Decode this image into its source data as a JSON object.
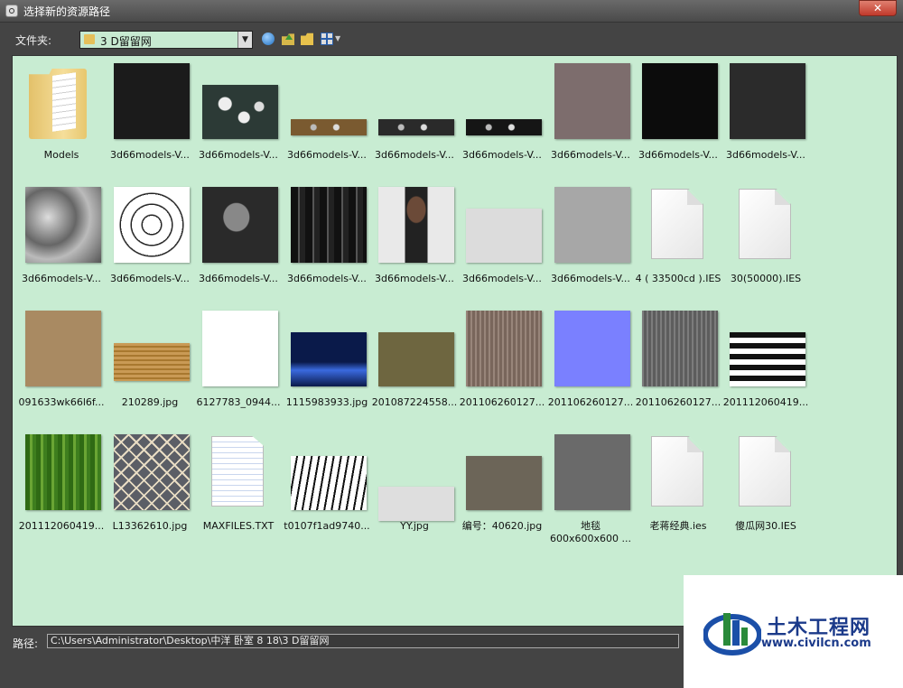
{
  "window": {
    "title": "选择新的资源路径",
    "close_label": "✕"
  },
  "toolbar": {
    "folder_label": "文件夹:",
    "current_folder": "3 D留留网"
  },
  "path": {
    "label": "路径:",
    "value": "C:\\Users\\Administrator\\Desktop\\中洋 卧室 8 18\\3 D留留网"
  },
  "watermark": {
    "brand": "土木工程网",
    "url": "www.civilcn.com"
  },
  "files": [
    {
      "label": "Models",
      "kind": "folder"
    },
    {
      "label": "3d66models-V...",
      "kind": "img",
      "color": "#1b1b1b",
      "shape": "sq"
    },
    {
      "label": "3d66models-V...",
      "kind": "img",
      "color": "#2c3a36",
      "shape": "wide",
      "pattern": "dandelion"
    },
    {
      "label": "3d66models-V...",
      "kind": "img",
      "color": "#7a5a30",
      "shape": "strip"
    },
    {
      "label": "3d66models-V...",
      "kind": "img",
      "color": "#2a2a2a",
      "shape": "strip"
    },
    {
      "label": "3d66models-V...",
      "kind": "img",
      "color": "#151515",
      "shape": "strip"
    },
    {
      "label": "3d66models-V...",
      "kind": "img",
      "color": "#7d6d6d",
      "shape": "sq"
    },
    {
      "label": "3d66models-V...",
      "kind": "img",
      "color": "#0c0c0c",
      "shape": "sq"
    },
    {
      "label": "3d66models-V...",
      "kind": "img",
      "color": "#2b2b2b",
      "shape": "sq"
    },
    {
      "label": "3d66models-V...",
      "kind": "img",
      "color": "#8b8b8b",
      "shape": "sq",
      "pattern": "marble"
    },
    {
      "label": "3d66models-V...",
      "kind": "img",
      "color": "#ffffff",
      "shape": "sq",
      "pattern": "flower"
    },
    {
      "label": "3d66models-V...",
      "kind": "img",
      "color": "#2a2a2a",
      "shape": "sq",
      "pattern": "leaf"
    },
    {
      "label": "3d66models-V...",
      "kind": "img",
      "color": "#1f1f1f",
      "shape": "sq",
      "pattern": "stripes-v"
    },
    {
      "label": "3d66models-V...",
      "kind": "img",
      "color": "#e9e9e9",
      "shape": "sq",
      "pattern": "person"
    },
    {
      "label": "3d66models-V...",
      "kind": "img",
      "color": "#dcdcdc",
      "shape": "wide"
    },
    {
      "label": "3d66models-V...",
      "kind": "img",
      "color": "#a7a7a7",
      "shape": "sq"
    },
    {
      "label": "4 ( 33500cd ).IES",
      "kind": "doc"
    },
    {
      "label": "30(50000).IES",
      "kind": "doc"
    },
    {
      "label": "091633wk66l6f...",
      "kind": "img",
      "color": "#a98a62",
      "shape": "sq"
    },
    {
      "label": "210289.jpg",
      "kind": "img",
      "color": "#b98a45",
      "shape": "strip2",
      "pattern": "wood"
    },
    {
      "label": "6127783_0944...",
      "kind": "img",
      "color": "#ffffff",
      "shape": "sq",
      "pattern": "tower"
    },
    {
      "label": "1115983933.jpg",
      "kind": "img",
      "color": "#0e2a6a",
      "shape": "wide",
      "pattern": "city"
    },
    {
      "label": "201087224558...",
      "kind": "img",
      "color": "#6e6640",
      "shape": "wide"
    },
    {
      "label": "201106260127...",
      "kind": "img",
      "color": "#8a7468",
      "shape": "sq",
      "pattern": "stripes-fine"
    },
    {
      "label": "201106260127...",
      "kind": "img",
      "color": "#7a80ff",
      "shape": "sq"
    },
    {
      "label": "201106260127...",
      "kind": "img",
      "color": "#6a6a6a",
      "shape": "sq",
      "pattern": "stripes-fine"
    },
    {
      "label": "201112060419...",
      "kind": "img",
      "color": "#ffffff",
      "shape": "wide",
      "pattern": "bw-stripes"
    },
    {
      "label": "201112060419...",
      "kind": "img",
      "color": "#3f7a1e",
      "shape": "sq",
      "pattern": "green-stripes"
    },
    {
      "label": "L13362610.jpg",
      "kind": "img",
      "color": "#5b5e66",
      "shape": "sq",
      "pattern": "lattice"
    },
    {
      "label": "MAXFILES.TXT",
      "kind": "txt"
    },
    {
      "label": "t0107f1ad9740...",
      "kind": "img",
      "color": "#ffffff",
      "shape": "wide",
      "pattern": "branches"
    },
    {
      "label": "YY.jpg",
      "kind": "img",
      "color": "#dedede",
      "shape": "strip3"
    },
    {
      "label": "编号：40620.jpg",
      "kind": "img",
      "color": "#6c6558",
      "shape": "wide"
    },
    {
      "label": "地毯\n600x600x600 ...",
      "kind": "img",
      "color": "#6a6a6a",
      "shape": "sq",
      "two": true
    },
    {
      "label": "老蒋经典.ies",
      "kind": "doc"
    },
    {
      "label": "傻瓜网30.IES",
      "kind": "doc"
    }
  ]
}
